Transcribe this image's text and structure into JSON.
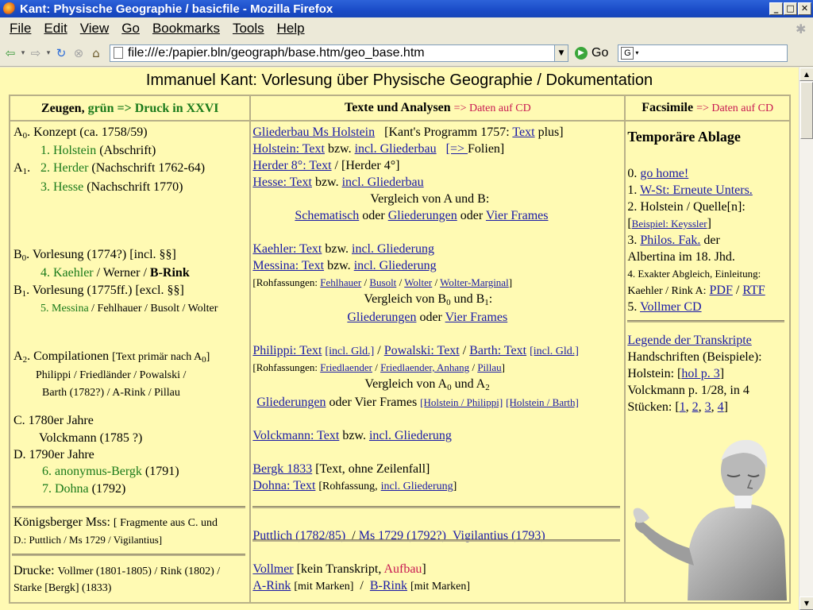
{
  "window": {
    "title": "Kant: Physische Geographie / basicfile - Mozilla Firefox",
    "buttons": {
      "minimize": "_",
      "maximize": "□",
      "close": "✕"
    }
  },
  "menu": [
    "File",
    "Edit",
    "View",
    "Go",
    "Bookmarks",
    "Tools",
    "Help"
  ],
  "nav": {
    "url": "file:///e:/papier.bln/geograph/base.htm/geo_base.htm",
    "go_label": "Go",
    "search_placeholder": ""
  },
  "page": {
    "title": "Immanuel Kant: Vorlesung über Physische Geographie / Dokumentation"
  },
  "col1": {
    "header_main": "Zeugen,",
    "header_note": "grün => Druck in XXVI",
    "a0": {
      "label": "A",
      "sub": "0",
      "text": ". Konzept (ca. 1758/59)"
    },
    "holstein": {
      "num": "1. Holstein",
      "rest": "(Abschrift)"
    },
    "a1": {
      "label": "A",
      "sub": "1",
      "text": "."
    },
    "herder": {
      "num": "2. Herder",
      "rest": "(Nachschrift 1762-64)"
    },
    "hesse": {
      "num": "3. Hesse",
      "rest": "(Nachschrift 1770)"
    },
    "b0": {
      "label": "B",
      "sub": "0",
      "text": ". Vorlesung (1774?) [incl. §§]"
    },
    "kaehler": {
      "num": "4. Kaehler",
      "rest": "/ Werner /",
      "bold": "B-Rink"
    },
    "b1": {
      "label": "B",
      "sub": "1",
      "text": ". Vorlesung (1775ff.) [excl. §§]"
    },
    "messina": {
      "num": "5. Messina",
      "rest": "/ Fehlhauer / Busolt / Wolter"
    },
    "a2": {
      "label": "A",
      "sub": "2",
      "text": ". Compilationen",
      "note": "[Text primär nach A",
      "note_sub": "0",
      "note_end": "]"
    },
    "a2_line2": "Philippi / Friedländer / Powalski /",
    "a2_line3": "Barth (1782?) / A-Rink / Pillau",
    "c": "C. 1780er Jahre",
    "volckmann": "Volckmann (1785 ?)",
    "d": "D. 1790er Jahre",
    "bergk": {
      "num": "6. anonymus-Bergk",
      "rest": "(1791)"
    },
    "dohna": {
      "num": "7. Dohna",
      "rest": "(1792)"
    },
    "koenigsberger": {
      "label": "Königsberger Mss:",
      "note": "[ Fragmente aus C. und"
    },
    "koenigsberger2": "D.:  Puttlich / Ms 1729 / Vigilantius]",
    "drucke": {
      "label": "Drucke:",
      "note": "Vollmer (1801-1805) / Rink (1802) /"
    },
    "drucke2": "Starke [Bergk] (1833)"
  },
  "col2": {
    "header_main": "Texte und Analysen",
    "header_note": "=> Daten auf CD",
    "gliederbau_ms": "Gliederbau Ms Holstein",
    "kants_prog_pre": "[Kant's Programm 1757:",
    "kants_prog_link": "Text",
    "kants_prog_post": "plus]",
    "holstein_text": "Holstein: Text",
    "bzw": "bzw.",
    "incl_gliederbau": "incl. Gliederbau",
    "folien_link": "[=> ",
    "folien_text": "Folien]",
    "herder_text": "Herder 8°: Text",
    "herder_4": "/  [Herder 4°]",
    "hesse_text": "Hesse: Text",
    "vergleich_ab": "Vergleich von A und B:",
    "schematisch": "Schematisch",
    "oder": "oder",
    "gliederungen": "Gliederungen",
    "vier_frames": "Vier Frames",
    "kaehler_text": "Kaehler: Text",
    "incl_gliederung": "incl. Gliederung",
    "messina_text": "Messina: Text",
    "rohf_pre": "[Rohfassungen:",
    "fehlhauer": "Fehlhauer",
    "busolt": "Busolt",
    "wolter": "Wolter",
    "wolter_marginal": "Wolter-Marginal",
    "rohf_end": "]",
    "vergleich_b": "Vergleich von B",
    "vergleich_b_mid": " und B",
    "vergleich_b_end": ":",
    "sub0": "0",
    "sub1": "1",
    "sub2": "2",
    "philippi_text": "Philippi: Text",
    "incl_gld": "[incl. Gld.]",
    "powalski_text": "Powalski: Text",
    "barth_text": "Barth: Text",
    "friedlaender": "Friedlaender",
    "friedlaender_anhang": "Friedlaender, Anhang",
    "pillau": "Pillau",
    "vergleich_a": "Vergleich von A",
    "vergleich_a_mid": " und A",
    "vier_frames_plain": "oder Vier Frames",
    "holstein_philippi": "[Holstein / Philippi]",
    "holstein_barth": "[Holstein / Barth]",
    "volckmann_text": "Volckmann: Text",
    "bergk_1833": "Bergk 1833",
    "bergk_note": "[Text, ohne Zeilenfall]",
    "dohna_text": "Dohna: Text",
    "rohfassung_pre": "[Rohfassung,",
    "rohfassung_end": "]",
    "puttlich": "Puttlich (1782/85)",
    "ms1729": "Ms 1729 (1792?)",
    "vigilantius": "Vigilantius (1793)",
    "vollmer": "Vollmer",
    "kein_transkript": "[kein Transkript,",
    "aufbau": "Aufbau",
    "a_rink": "A-Rink",
    "mit_marken": "[mit Marken]",
    "b_rink": "B-Rink",
    "slash": "/"
  },
  "col3": {
    "header_main": "Facsimile",
    "header_note": "=> Daten auf CD",
    "temp": "Temporäre Ablage",
    "item0_num": "0.",
    "item0_link": "go home!",
    "item1_num": "1.",
    "item1_link": "W-St: Erneute Unters.",
    "item2": "2. Holstein / Quelle[n]:",
    "beispiel_pre": "[",
    "beispiel_link": "Beispiel: Keyssler",
    "beispiel_end": "]",
    "item3_num": "3.",
    "item3_link": "Philos. Fak.",
    "item3_rest": "der",
    "albertina": "Albertina im 18. Jhd.",
    "item4": "4. Exakter Abgleich, Einleitung:",
    "kaehler_rink": "Kaehler / Rink A:",
    "pdf": "PDF",
    "rtf": "RTF",
    "item5_num": "5.",
    "item5_link": "Vollmer  CD",
    "legende": "Legende der Transkripte",
    "handschriften": "Handschriften (Beispiele):",
    "holstein_pre": "Holstein: [",
    "hol_p3": "hol  p. 3",
    "holstein_end": "]",
    "volckmann_p": "Volckmann p. 1/28, in 4",
    "stuecken_pre": "Stücken: [",
    "s1": "1",
    "s2": "2",
    "s3": "3",
    "s4": "4",
    "stuecken_end": "]",
    "comma": ","
  }
}
